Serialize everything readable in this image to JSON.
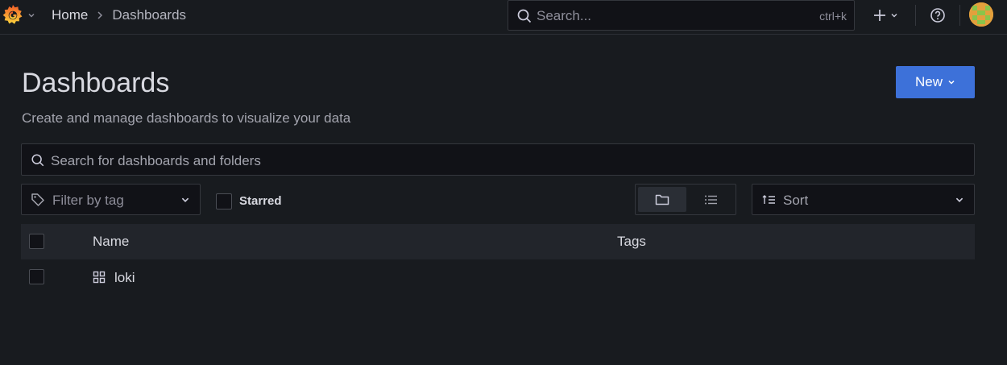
{
  "topbar": {
    "breadcrumb": {
      "home": "Home",
      "current": "Dashboards"
    },
    "search": {
      "placeholder": "Search...",
      "shortcut": "ctrl+k"
    },
    "icons": {
      "logo": "grafana-logo-icon",
      "add": "plus-icon",
      "help": "help-circle-icon"
    }
  },
  "page": {
    "title": "Dashboards",
    "subtitle": "Create and manage dashboards to visualize your data",
    "new_button": "New"
  },
  "filters": {
    "search_placeholder": "Search for dashboards and folders",
    "tag_placeholder": "Filter by tag",
    "starred_label": "Starred",
    "starred_checked": false,
    "view_mode": "folder",
    "sort_placeholder": "Sort"
  },
  "table": {
    "columns": {
      "name": "Name",
      "tags": "Tags"
    },
    "rows": [
      {
        "name": "loki",
        "type": "dashboard",
        "tags": []
      }
    ]
  },
  "colors": {
    "background": "#181b1f",
    "input_bg": "#111217",
    "primary": "#3d71d9",
    "header_row": "#22252b",
    "logo_orange": "#f46800"
  }
}
